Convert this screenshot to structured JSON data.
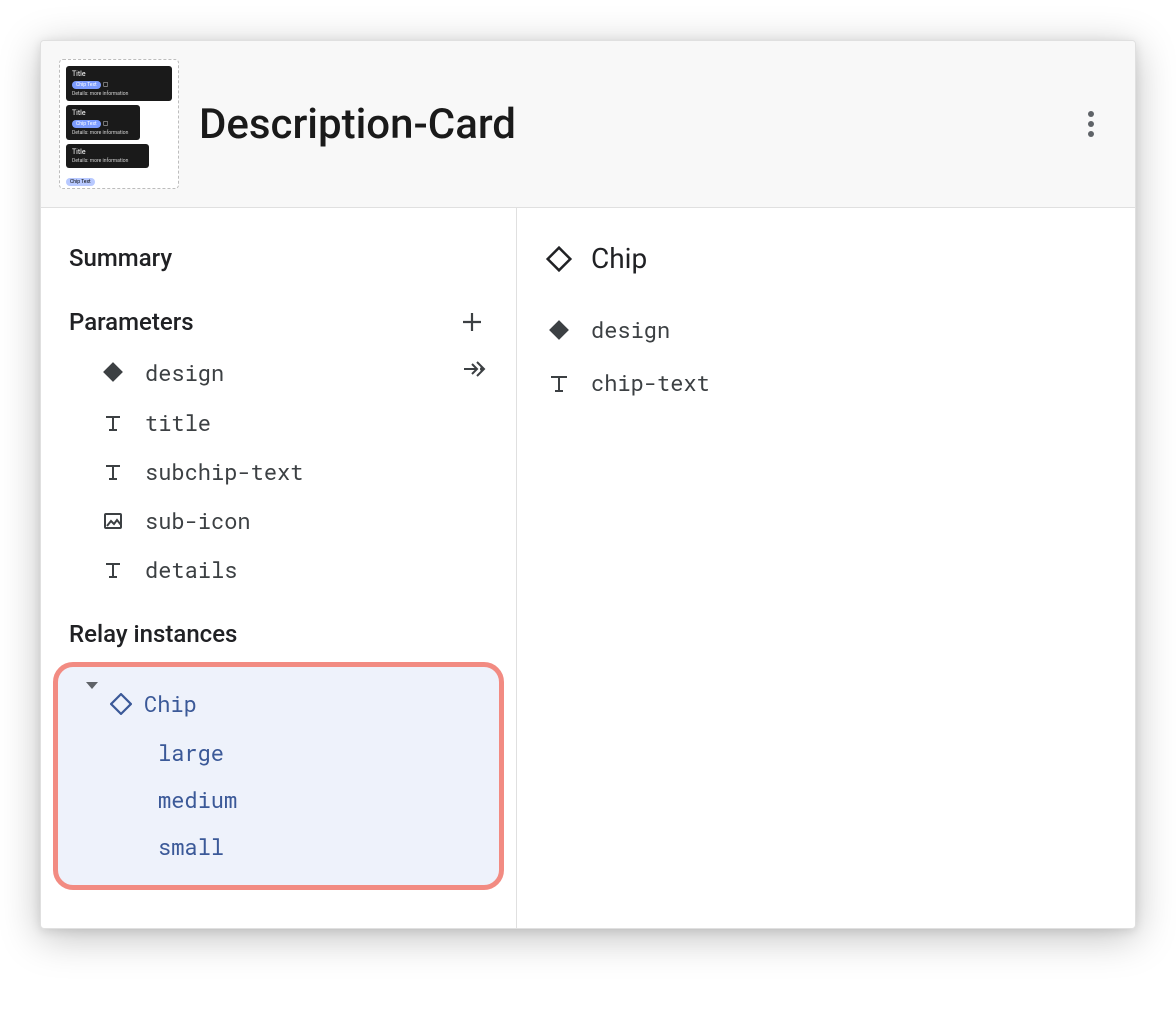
{
  "header": {
    "title": "Description-Card"
  },
  "thumbnail": {
    "card_title": "Title",
    "chip_text": "Chip Text",
    "details": "Details: more information"
  },
  "left": {
    "summary_heading": "Summary",
    "parameters_heading": "Parameters",
    "params": [
      {
        "icon": "diamond-filled",
        "label": "design",
        "trailing": "link"
      },
      {
        "icon": "text",
        "label": "title"
      },
      {
        "icon": "text",
        "label": "subchip-text"
      },
      {
        "icon": "image",
        "label": "sub-icon"
      },
      {
        "icon": "text",
        "label": "details"
      }
    ],
    "relay_heading": "Relay instances",
    "relay": {
      "name": "Chip",
      "variants": [
        "large",
        "medium",
        "small"
      ]
    }
  },
  "right": {
    "component_name": "Chip",
    "props": [
      {
        "icon": "diamond-filled",
        "label": "design"
      },
      {
        "icon": "text",
        "label": "chip-text"
      }
    ]
  }
}
